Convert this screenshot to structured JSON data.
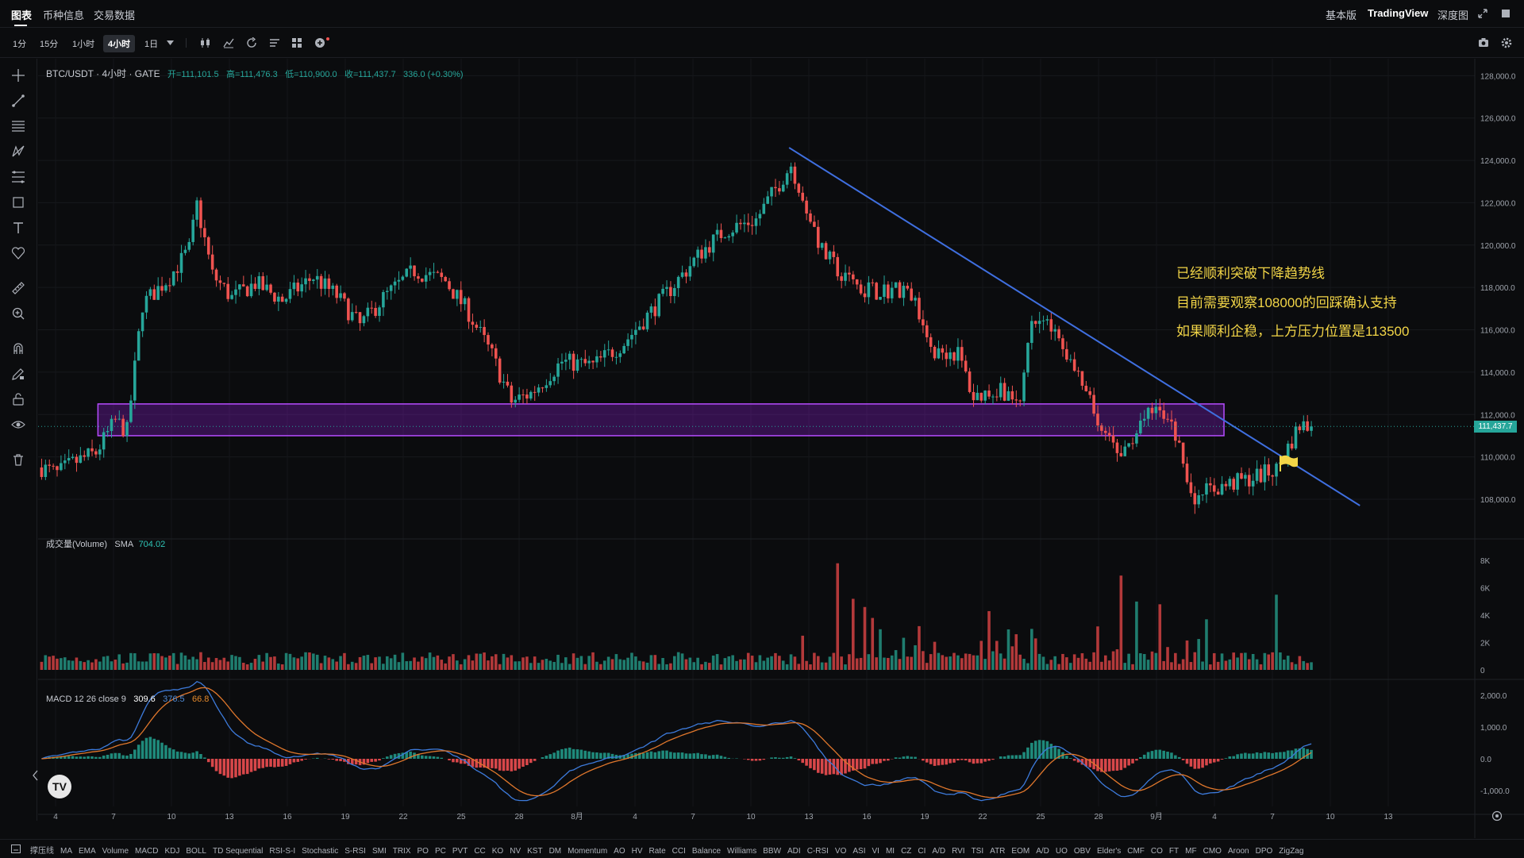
{
  "nav": {
    "tabs": [
      "图表",
      "币种信息",
      "交易数据"
    ],
    "right": [
      "基本版",
      "TradingView",
      "深度图"
    ]
  },
  "toolbar": {
    "timeframes": [
      "1分",
      "15分",
      "1小时",
      "4小时",
      "1日"
    ],
    "active_timeframe": "4小时"
  },
  "legend": {
    "symbol": "BTC/USDT · 4小时 · GATE",
    "open": "开=111,101.5",
    "high": "高=111,476.3",
    "low": "低=110,900.0",
    "close": "收=111,437.7",
    "change": "336.0 (+0.30%)",
    "volume_label": "成交量(Volume)",
    "volume_sma_label": "SMA",
    "volume_sma_value": "704.02",
    "macd_label": "MACD 12 26 close 9",
    "macd_v1": "309.6",
    "macd_v2": "376.5",
    "macd_v3": "66.8",
    "last_price": "111,437.7"
  },
  "annotations": [
    "已经顺利突破下降趋势线",
    "目前需要观察108000的回踩确认支持",
    "如果顺利企稳，上方压力位置是113500"
  ],
  "chart_data": {
    "type": "candlestick",
    "symbol": "BTC/USDT",
    "interval": "4小时",
    "price_axis_ticks": [
      "128,000.0",
      "126,000.0",
      "124,000.0",
      "122,000.0",
      "120,000.0",
      "118,000.0",
      "116,000.0",
      "114,000.0",
      "112,000.0",
      "110,000.0",
      "108,000.0"
    ],
    "price_ylim": [
      106500,
      128800
    ],
    "volume_axis_ticks": [
      "8K",
      "6K",
      "4K",
      "2K",
      "0"
    ],
    "macd_axis_ticks": [
      "2,000.0",
      "1,000.0",
      "0.0",
      "-1,000.0"
    ],
    "x_ticks": [
      "4",
      "7",
      "10",
      "13",
      "16",
      "19",
      "22",
      "25",
      "28",
      "8月",
      "4",
      "7",
      "10",
      "13",
      "16",
      "19",
      "22",
      "25",
      "28",
      "9月",
      "4",
      "7",
      "10",
      "13"
    ],
    "price_path_keypoints": [
      [
        0,
        109500
      ],
      [
        4,
        109200
      ],
      [
        8,
        109700
      ],
      [
        14,
        110200
      ],
      [
        19,
        111700
      ],
      [
        22,
        111200
      ],
      [
        26,
        117200
      ],
      [
        33,
        118500
      ],
      [
        38,
        119800
      ],
      [
        40,
        121900
      ],
      [
        44,
        118600
      ],
      [
        49,
        117500
      ],
      [
        55,
        118200
      ],
      [
        62,
        117400
      ],
      [
        70,
        118500
      ],
      [
        76,
        117600
      ],
      [
        82,
        116200
      ],
      [
        88,
        117500
      ],
      [
        96,
        118800
      ],
      [
        104,
        118300
      ],
      [
        110,
        116800
      ],
      [
        116,
        114800
      ],
      [
        121,
        112600
      ],
      [
        126,
        113000
      ],
      [
        134,
        114500
      ],
      [
        142,
        114300
      ],
      [
        150,
        115400
      ],
      [
        160,
        117500
      ],
      [
        170,
        119700
      ],
      [
        176,
        120700
      ],
      [
        184,
        121200
      ],
      [
        193,
        123800
      ],
      [
        197,
        121800
      ],
      [
        201,
        119700
      ],
      [
        208,
        118200
      ],
      [
        215,
        117800
      ],
      [
        223,
        118000
      ],
      [
        230,
        115000
      ],
      [
        236,
        114900
      ],
      [
        240,
        112800
      ],
      [
        247,
        113300
      ],
      [
        252,
        112300
      ],
      [
        255,
        116700
      ],
      [
        262,
        115600
      ],
      [
        268,
        113300
      ],
      [
        273,
        111300
      ],
      [
        278,
        109800
      ],
      [
        283,
        111700
      ],
      [
        288,
        112200
      ],
      [
        292,
        111100
      ],
      [
        296,
        108100
      ],
      [
        302,
        108500
      ],
      [
        310,
        108900
      ],
      [
        318,
        109400
      ],
      [
        324,
        111500
      ],
      [
        327,
        111437.7
      ]
    ],
    "resistance_zone": {
      "from": 111000,
      "to": 112500
    },
    "trendline": [
      [
        193,
        124600
      ],
      [
        340,
        107700
      ]
    ],
    "last_close": 111437.7,
    "volume_sma": 704.02,
    "macd": {
      "params": "12 26 close 9",
      "macd": 309.6,
      "signal": 376.5,
      "histogram": 66.8
    }
  },
  "indicators": [
    "撑压线",
    "MA",
    "EMA",
    "Volume",
    "MACD",
    "KDJ",
    "BOLL",
    "TD Sequential",
    "RSI-S-I",
    "Stochastic",
    "S-RSI",
    "SMI",
    "TRIX",
    "PO",
    "PC",
    "PVT",
    "CC",
    "KO",
    "NV",
    "KST",
    "DM",
    "Momentum",
    "AO",
    "HV",
    "Rate",
    "CCI",
    "Balance",
    "Williams",
    "BBW",
    "ADI",
    "C-RSI",
    "VO",
    "ASI",
    "VI",
    "MI",
    "CZ",
    "CI",
    "A/D",
    "RVI",
    "TSI",
    "ATR",
    "EOM",
    "A/D",
    "UO",
    "OBV",
    "Elder's",
    "CMF",
    "CO",
    "FT",
    "MF",
    "CMO",
    "Aroon",
    "DPO",
    "ZigZag"
  ],
  "colors": {
    "up": "#26a69a",
    "down": "#ef5350",
    "zone": "#a020f0",
    "trend": "#3f6fe0",
    "note": "#f2d547",
    "macd_line": "#3d7bdc",
    "signal_line": "#e0772c"
  },
  "icons": {
    "logo": "TV"
  }
}
